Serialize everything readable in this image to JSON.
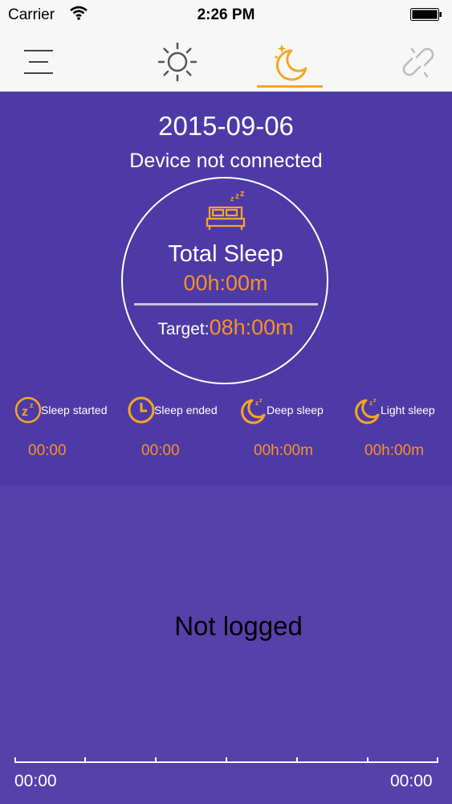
{
  "status_bar": {
    "carrier": "Carrier",
    "time": "2:26 PM"
  },
  "nav": {
    "items": [
      {
        "icon": "menu-icon"
      },
      {
        "icon": "sun-icon"
      },
      {
        "icon": "moon-icon",
        "active": true
      },
      {
        "icon": "link-icon"
      }
    ],
    "accent_color": "#f6a623"
  },
  "header": {
    "date": "2015-09-06",
    "device_status": "Device not connected"
  },
  "summary": {
    "icon": "bed-icon",
    "total_label": "Total Sleep",
    "total_value": "00h:00m",
    "target_label": "Target:",
    "target_value": "08h:00m"
  },
  "stats": [
    {
      "icon": "zz-icon",
      "label": "Sleep started",
      "value": "00:00"
    },
    {
      "icon": "clock-icon",
      "label": "Sleep ended",
      "value": "00:00"
    },
    {
      "icon": "deep-moon-icon",
      "label": "Deep sleep",
      "value": "00h:00m"
    },
    {
      "icon": "light-moon-icon",
      "label": "Light sleep",
      "value": "00h:00m"
    }
  ],
  "chart": {
    "empty_message": "Not logged",
    "start_time": "00:00",
    "end_time": "00:00"
  },
  "colors": {
    "background": "#4e3aa6",
    "lower_panel": "#5641aa",
    "value_orange": "#f5922a"
  }
}
